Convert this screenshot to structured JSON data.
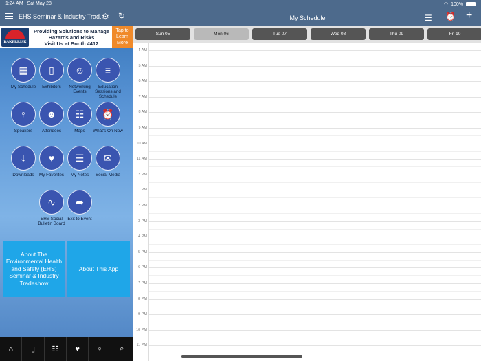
{
  "status_bar": {
    "time": "1:24 AM",
    "date": "Sat May 28",
    "battery": "100%"
  },
  "left_header": {
    "title": "EHS Seminar & Industry Trad..."
  },
  "banner": {
    "logo_text": "BAKERRISK",
    "headline": "Providing Solutions to Manage Hazards and Risks",
    "subline": "Visit Us at Booth #412",
    "cta": "Tap to Learn More",
    "accent": "#f08a2a"
  },
  "tiles": [
    {
      "id": "my-schedule",
      "label": "My Schedule",
      "icon": "calendar-icon",
      "glyph": "▦"
    },
    {
      "id": "exhibitors",
      "label": "Exhibitors",
      "icon": "phone-icon",
      "glyph": "▯"
    },
    {
      "id": "networking-events",
      "label": "Networking Events",
      "icon": "people-icon",
      "glyph": "☺"
    },
    {
      "id": "education-sessions",
      "label": "Education Sessions and Schedule",
      "icon": "books-icon",
      "glyph": "≡"
    },
    {
      "id": "speakers",
      "label": "Speakers",
      "icon": "speaker-icon",
      "glyph": "♀"
    },
    {
      "id": "attendees",
      "label": "Attendees",
      "icon": "attendees-icon",
      "glyph": "☻"
    },
    {
      "id": "maps",
      "label": "Maps",
      "icon": "grid-icon",
      "glyph": "☷"
    },
    {
      "id": "whats-on-now",
      "label": "What's On Now",
      "icon": "alarm-clock-icon",
      "glyph": "⏰"
    },
    {
      "id": "downloads",
      "label": "Downloads",
      "icon": "download-icon",
      "glyph": "⤓"
    },
    {
      "id": "my-favorites",
      "label": "My Favorites",
      "icon": "heart-icon",
      "glyph": "♥"
    },
    {
      "id": "my-notes",
      "label": "My Notes",
      "icon": "list-icon",
      "glyph": "☰"
    },
    {
      "id": "social-media",
      "label": "Social Media",
      "icon": "chat-bubble-icon",
      "glyph": "✉"
    },
    {
      "id": "social-bulletin",
      "label": "EHS Social Bulletin Board",
      "icon": "pulse-icon",
      "glyph": "∿"
    },
    {
      "id": "exit-event",
      "label": "Exit to Event",
      "icon": "share-arrow-icon",
      "glyph": "➦"
    }
  ],
  "about_buttons": {
    "about_event": "About The Environmental Health and Safety (EHS) Seminar & Industry Tradeshow",
    "about_app": "About This App"
  },
  "tabbar": [
    {
      "id": "home",
      "icon": "home-icon",
      "glyph": "⌂"
    },
    {
      "id": "phone",
      "icon": "phone-icon",
      "glyph": "▯"
    },
    {
      "id": "grid",
      "icon": "grid-icon",
      "glyph": "☷"
    },
    {
      "id": "favorites",
      "icon": "heart-icon",
      "glyph": "♥"
    },
    {
      "id": "speakers",
      "icon": "speaker-icon",
      "glyph": "♀"
    },
    {
      "id": "search",
      "icon": "search-icon",
      "glyph": "⌕"
    }
  ],
  "right_header": {
    "title": "My Schedule"
  },
  "days": [
    {
      "label": "Sun 05",
      "selected": false
    },
    {
      "label": "Mon 06",
      "selected": true
    },
    {
      "label": "Tue 07",
      "selected": false
    },
    {
      "label": "Wed 08",
      "selected": false
    },
    {
      "label": "Thu 09",
      "selected": false
    },
    {
      "label": "Fri 10",
      "selected": false
    }
  ],
  "hours": [
    "4 AM",
    "5 AM",
    "6 AM",
    "7 AM",
    "8 AM",
    "9 AM",
    "10 AM",
    "11 AM",
    "12 PM",
    "1 PM",
    "2 PM",
    "3 PM",
    "4 PM",
    "5 PM",
    "6 PM",
    "7 PM",
    "8 PM",
    "9 PM",
    "10 PM",
    "11 PM"
  ]
}
